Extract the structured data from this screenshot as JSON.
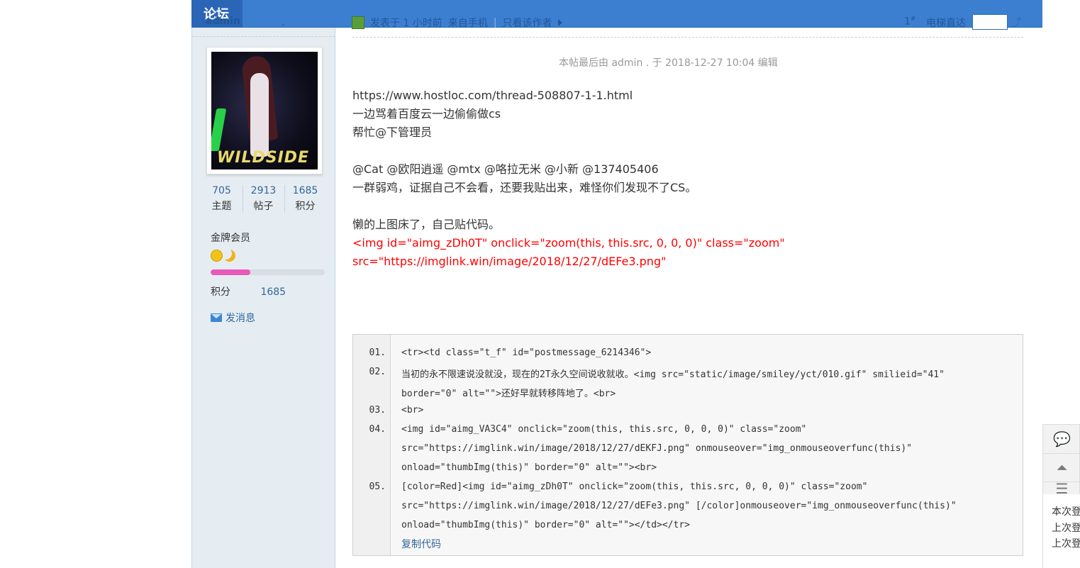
{
  "header": {
    "forum_tab": "论坛",
    "author": "admin",
    "dot": ".",
    "posted_text": "发表于 1 小时前",
    "source_text": "来自手机",
    "sep": "|",
    "only_author": "只看该作者",
    "floor": "1",
    "floor_sup": "#",
    "elevator_label": "电梯直达",
    "elevator_value": ""
  },
  "user": {
    "stats": [
      {
        "num": "705",
        "label": "主题"
      },
      {
        "num": "2913",
        "label": "帖子"
      },
      {
        "num": "1685",
        "label": "积分"
      }
    ],
    "rank": "金牌会员",
    "level_progress": 0.35,
    "score_label": "积分",
    "score_value": "1685",
    "send_message": "发消息",
    "avatar_text": "WILDSIDE"
  },
  "post": {
    "edit_note": "本帖最后由 admin             . 于 2018-12-27 10:04 编辑",
    "lines": [
      "https://www.hostloc.com/thread-508807-1-1.html",
      "一边骂着百度云一边偷偷做cs",
      "帮忙@下管理员",
      "",
      "@Cat @欧阳逍遥 @mtx @咯拉无米 @小新 @137405406",
      "一群弱鸡，证据自己不会看，还要我贴出来，难怪你们发现不了CS。",
      "",
      "懒的上图床了，自己贴代码。"
    ],
    "red_lines": [
      "<img id=\"aimg_zDh0T\" onclick=\"zoom(this, this.src, 0, 0, 0)\" class=\"zoom\"",
      "src=\"https://imglink.win/image/2018/12/27/dEFe3.png\""
    ]
  },
  "code": {
    "l1_num": "01.",
    "l1": "<tr><td class=\"t_f\" id=\"postmessage_6214346\">",
    "l2_num": "02.",
    "l2a": "当初的永不限速说没就没，现在的2T永久空间说收就收。<img src=\"static/image/smiley/yct/010.gif\" smilieid=\"41\"",
    "l2b": "border=\"0\" alt=\"\">还好早就转移阵地了。<br>",
    "l3_num": "03.",
    "l3": "<br>",
    "l4_num": "04.",
    "l4a": "<img id=\"aimg_VA3C4\" onclick=\"zoom(this, this.src, 0, 0, 0)\" class=\"zoom\"",
    "l4b": "src=\"https://imglink.win/image/2018/12/27/dEKFJ.png\" onmouseover=\"img_onmouseoverfunc(this)\"",
    "l4c": "onload=\"thumbImg(this)\" border=\"0\" alt=\"\"><br>",
    "l5_num": "05.",
    "l5a": "[color=Red]<img id=\"aimg_zDh0T\" onclick=\"zoom(this, this.src, 0, 0, 0)\" class=\"zoom\"",
    "l5b": "src=\"https://imglink.win/image/2018/12/27/dEFe3.png\" [/color]onmouseover=\"img_onmouseoverfunc(this)\"",
    "l5c": "onload=\"thumbImg(this)\" border=\"0\" alt=\"\"></td></tr>",
    "copy": "复制代码"
  },
  "side_panel": {
    "line1": "本次登",
    "line2": "上次登",
    "line3": "上次登"
  }
}
